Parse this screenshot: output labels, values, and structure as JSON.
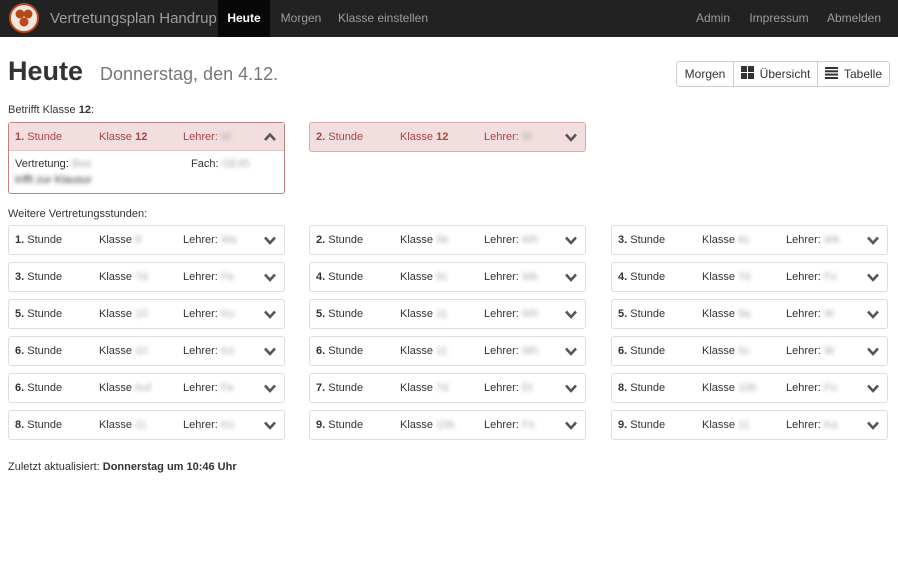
{
  "nav": {
    "brand": "Vertretungsplan Handrup",
    "items": [
      {
        "label": "Heute",
        "active": true
      },
      {
        "label": "Morgen",
        "active": false
      },
      {
        "label": "Klasse einstellen",
        "active": false
      }
    ],
    "right_items": [
      "Admin",
      "Impressum",
      "Abmelden"
    ]
  },
  "header": {
    "title": "Heute",
    "date": "Donnerstag, den 4.12.",
    "buttons": [
      "Morgen",
      "Übersicht",
      "Tabelle"
    ]
  },
  "own": {
    "label_prefix": "Betrifft Klasse ",
    "label_class": "12",
    "label_suffix": ":",
    "cards": [
      {
        "hour": "1.",
        "hour_suffix": " Stunde",
        "klasse_prefix": "Klasse ",
        "klasse": "12",
        "lehrer_prefix": "Lehrer: ",
        "lehrer": "W",
        "expanded": true,
        "vertretung_label": "Vertretung: ",
        "vertretung": "Bee",
        "vertretung2": "trifft zur Klausur",
        "fach_label": "Fach: ",
        "fach": "GE45"
      },
      {
        "hour": "2.",
        "hour_suffix": " Stunde",
        "klasse_prefix": "Klasse ",
        "klasse": "12",
        "lehrer_prefix": "Lehrer: ",
        "lehrer": "W",
        "expanded": false
      }
    ]
  },
  "more": {
    "label": "Weitere Vertretungsstunden:",
    "cards": [
      {
        "hour": "1.",
        "hour_suffix": " Stunde",
        "klasse_prefix": "Klasse ",
        "klasse": "8",
        "lehrer_prefix": "Lehrer: ",
        "lehrer": "Wa"
      },
      {
        "hour": "2.",
        "hour_suffix": " Stunde",
        "klasse_prefix": "Klasse ",
        "klasse": "5b",
        "lehrer_prefix": "Lehrer: ",
        "lehrer": "Wh"
      },
      {
        "hour": "3.",
        "hour_suffix": " Stunde",
        "klasse_prefix": "Klasse ",
        "klasse": "6c",
        "lehrer_prefix": "Lehrer: ",
        "lehrer": "Wk"
      },
      {
        "hour": "3.",
        "hour_suffix": " Stunde",
        "klasse_prefix": "Klasse ",
        "klasse": "7d",
        "lehrer_prefix": "Lehrer: ",
        "lehrer": "Fe"
      },
      {
        "hour": "4.",
        "hour_suffix": " Stunde",
        "klasse_prefix": "Klasse ",
        "klasse": "6c",
        "lehrer_prefix": "Lehrer: ",
        "lehrer": "Wk"
      },
      {
        "hour": "4.",
        "hour_suffix": " Stunde",
        "klasse_prefix": "Klasse ",
        "klasse": "7d",
        "lehrer_prefix": "Lehrer: ",
        "lehrer": "Fo"
      },
      {
        "hour": "5.",
        "hour_suffix": " Stunde",
        "klasse_prefix": "Klasse ",
        "klasse": "10",
        "lehrer_prefix": "Lehrer: ",
        "lehrer": "Ko"
      },
      {
        "hour": "5.",
        "hour_suffix": " Stunde",
        "klasse_prefix": "Klasse ",
        "klasse": "11",
        "lehrer_prefix": "Lehrer: ",
        "lehrer": "Wh"
      },
      {
        "hour": "5.",
        "hour_suffix": " Stunde",
        "klasse_prefix": "Klasse ",
        "klasse": "9a",
        "lehrer_prefix": "Lehrer: ",
        "lehrer": "W"
      },
      {
        "hour": "6.",
        "hour_suffix": " Stunde",
        "klasse_prefix": "Klasse ",
        "klasse": "10",
        "lehrer_prefix": "Lehrer: ",
        "lehrer": "Ko"
      },
      {
        "hour": "6.",
        "hour_suffix": " Stunde",
        "klasse_prefix": "Klasse ",
        "klasse": "11",
        "lehrer_prefix": "Lehrer: ",
        "lehrer": "Wh"
      },
      {
        "hour": "6.",
        "hour_suffix": " Stunde",
        "klasse_prefix": "Klasse ",
        "klasse": "5c",
        "lehrer_prefix": "Lehrer: ",
        "lehrer": "W"
      },
      {
        "hour": "6.",
        "hour_suffix": " Stunde",
        "klasse_prefix": "Klasse ",
        "klasse": "Auf",
        "lehrer_prefix": "Lehrer: ",
        "lehrer": "Fe"
      },
      {
        "hour": "7.",
        "hour_suffix": " Stunde",
        "klasse_prefix": "Klasse ",
        "klasse": "7d",
        "lehrer_prefix": "Lehrer: ",
        "lehrer": "Et"
      },
      {
        "hour": "8.",
        "hour_suffix": " Stunde",
        "klasse_prefix": "Klasse ",
        "klasse": "10b",
        "lehrer_prefix": "Lehrer: ",
        "lehrer": "Fo"
      },
      {
        "hour": "8.",
        "hour_suffix": " Stunde",
        "klasse_prefix": "Klasse ",
        "klasse": "11",
        "lehrer_prefix": "Lehrer: ",
        "lehrer": "Ko"
      },
      {
        "hour": "9.",
        "hour_suffix": " Stunde",
        "klasse_prefix": "Klasse ",
        "klasse": "10b",
        "lehrer_prefix": "Lehrer: ",
        "lehrer": "Fo"
      },
      {
        "hour": "9.",
        "hour_suffix": " Stunde",
        "klasse_prefix": "Klasse ",
        "klasse": "11",
        "lehrer_prefix": "Lehrer: ",
        "lehrer": "Ka"
      }
    ]
  },
  "footer": {
    "prefix": "Zuletzt aktualisiert: ",
    "value": "Donnerstag um 10:46 Uhr"
  },
  "colors": {
    "navbar": "#222222",
    "own_bg": "#f2dede",
    "own_text": "#a94442"
  },
  "icons": [
    "logo-icon",
    "grid-icon",
    "list-icon",
    "chevron-down-icon",
    "chevron-up-icon"
  ]
}
